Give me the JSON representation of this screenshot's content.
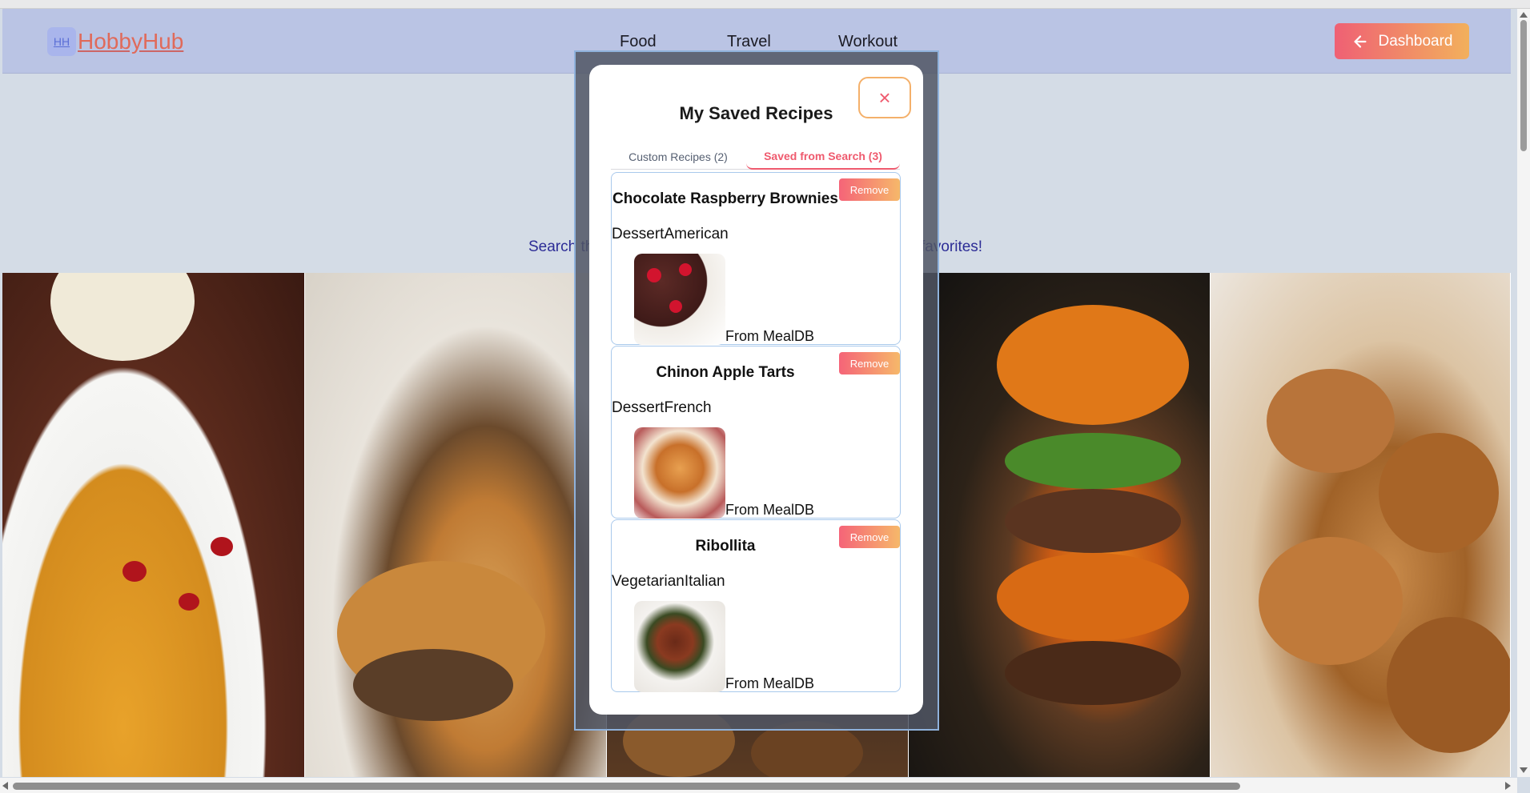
{
  "header": {
    "logo_badge": "HH",
    "logo_text": "HobbyHub",
    "nav": [
      "Food",
      "Travel",
      "Workout"
    ],
    "dashboard_label": "Dashboard"
  },
  "hero": {
    "text_left": "Search th",
    "text_right": "favorites!"
  },
  "modal": {
    "title": "My Saved Recipes",
    "close_icon": "×",
    "tabs": [
      {
        "label": "Custom Recipes (2)",
        "active": false
      },
      {
        "label": "Saved from Search (3)",
        "active": true
      }
    ],
    "recipes": [
      {
        "title": "Chocolate Raspberry Brownies",
        "tags": "DessertAmerican",
        "source": "From MealDB",
        "remove_label": "Remove",
        "image": "brownies-photo"
      },
      {
        "title": "Chinon Apple Tarts",
        "tags": "DessertFrench",
        "source": "From MealDB",
        "remove_label": "Remove",
        "image": "apple-tart-photo"
      },
      {
        "title": "Ribollita",
        "tags": "VegetarianItalian",
        "source": "From MealDB",
        "remove_label": "Remove",
        "image": "ribollita-soup-photo"
      }
    ]
  },
  "colors": {
    "accent_start": "#ef6074",
    "accent_end": "#f2b05c",
    "header_bg": "#bac4e4"
  }
}
